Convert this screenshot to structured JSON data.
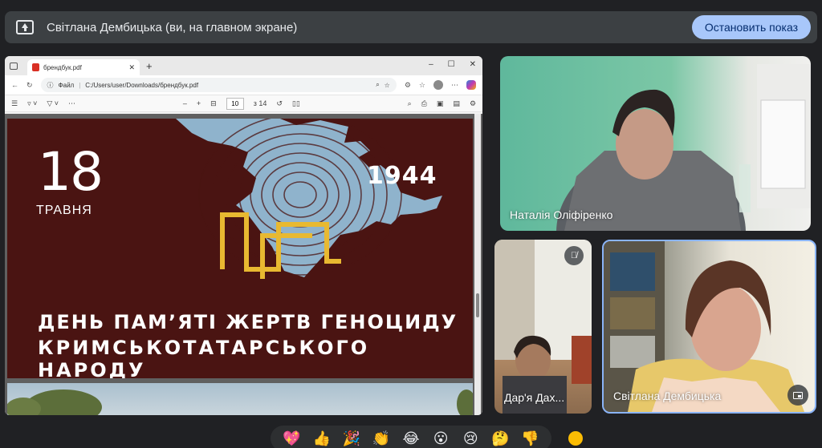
{
  "banner": {
    "title": "Світлана Дембицька (ви, на главном экране)",
    "stop_label": "Остановить показ"
  },
  "browser": {
    "tab_title": "брендбук.pdf",
    "new_tab": "+",
    "win_min": "–",
    "win_max": "☐",
    "win_close": "✕",
    "url_label": "Файл",
    "url_path": "C:/Users/user/Downloads/брендбук.pdf",
    "zoom_minus": "–",
    "zoom_plus": "+",
    "page_current": "10",
    "page_total": "з 14"
  },
  "slide": {
    "day": "18",
    "month": "ТРАВНЯ",
    "year": "1944",
    "line1": "ДЕНЬ ПАМ’ЯТІ ЖЕРТВ ГЕНОЦИДУ",
    "line2": "КРИМСЬКОТАТАРСЬКОГО  НАРОДУ"
  },
  "participants": [
    {
      "name": "Наталія Оліфіренко"
    },
    {
      "name": "Дар'я Дах..."
    },
    {
      "name": "Світлана Дембицька"
    }
  ],
  "reactions": [
    "💖",
    "👍",
    "🎉",
    "👏",
    "😂",
    "😮",
    "😢",
    "🤔",
    "👎"
  ],
  "colors": {
    "slide_bg": "#4a1412",
    "accent": "#a8c7fa",
    "tamga": "#e8b931",
    "map": "#8fb3cc"
  }
}
